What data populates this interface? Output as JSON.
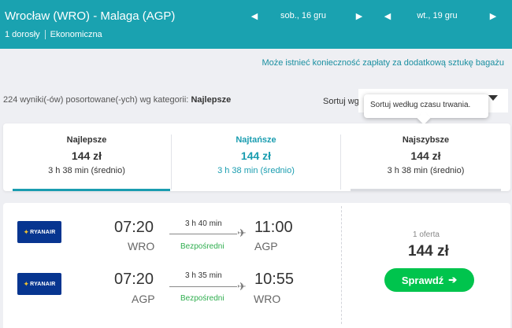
{
  "header": {
    "route": "Wrocław (WRO) - Malaga (AGP)",
    "passengers": "1 dorosły",
    "cabin": "Ekonomiczna",
    "depart_date": "sob., 16 gru",
    "return_date": "wt., 19 gru",
    "background": "#1aa2b0"
  },
  "notice": "Może istnieć konieczność zapłaty za dodatkową sztukę bagażu",
  "results": {
    "count_text": "224 wyniki(-ów) posortowane(-ych) wg kategorii:",
    "sort_category": "Najlepsze"
  },
  "sort": {
    "label": "Sortuj wg",
    "tooltip": "Sortuj według czasu trwania."
  },
  "tabs": [
    {
      "title": "Najlepsze",
      "price": "144 zł",
      "duration": "3 h 38 min (średnio)",
      "active": true
    },
    {
      "title": "Najtańsze",
      "price": "144 zł",
      "duration": "3 h 38 min (średnio)",
      "active": false
    },
    {
      "title": "Najszybsze",
      "price": "144 zł",
      "duration": "3 h 38 min (średnio)",
      "active": false
    }
  ],
  "itinerary": {
    "legs": [
      {
        "airline": "RYANAIR",
        "depart_time": "07:20",
        "depart_code": "WRO",
        "duration": "3 h 40 min",
        "stops": "Bezpośredni",
        "arrive_time": "11:00",
        "arrive_code": "AGP"
      },
      {
        "airline": "RYANAIR",
        "depart_time": "07:20",
        "depart_code": "AGP",
        "duration": "3 h 35 min",
        "stops": "Bezpośredni",
        "arrive_time": "10:55",
        "arrive_code": "WRO"
      }
    ],
    "offers": "1 oferta",
    "price": "144 zł",
    "cta": "Sprawdź"
  },
  "colors": {
    "accent": "#1a9db0",
    "direct": "#2fae4f",
    "cta": "#00c44d",
    "ryanair": "#073590"
  }
}
